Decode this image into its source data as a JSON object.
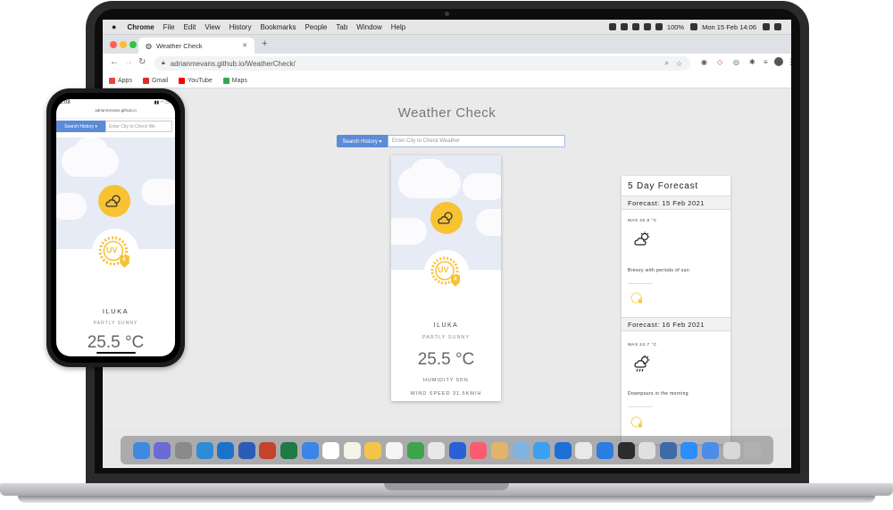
{
  "menubar": {
    "apple": "",
    "app": "Chrome",
    "items": [
      "File",
      "Edit",
      "View",
      "History",
      "Bookmarks",
      "People",
      "Tab",
      "Window",
      "Help"
    ],
    "battery": "100%",
    "datetime": "Mon 15 Feb  14:06"
  },
  "browser": {
    "tab_title": "Weather Check",
    "new_tab": "+",
    "tab_close": "✕",
    "url": "adrianmevans.github.io/WeatherCheck/",
    "bookmarks": [
      {
        "label": "Apps",
        "color": "#e8453c"
      },
      {
        "label": "Gmail",
        "color": "#d93025"
      },
      {
        "label": "YouTube",
        "color": "#ff0000"
      },
      {
        "label": "Maps",
        "color": "#34a853"
      }
    ]
  },
  "app": {
    "title": "Weather Check",
    "search_history_label": "Search History ▾",
    "city_placeholder": "Enter City to Check Weather",
    "city": "ILUKA",
    "condition": "PARTLY SUNNY",
    "temperature": "25.5 °C",
    "humidity": "HUMIDITY 55%",
    "wind": "WIND SPEED 31.5KM/H",
    "uv_text": "UV",
    "uv_index": "4"
  },
  "forecast": {
    "title": "5 Day Forecast",
    "days": [
      {
        "date": "Forecast: 15 Feb 2021",
        "max": "MAX 25.8 °C",
        "desc": "Breezy with periods of sun",
        "uv": "4"
      },
      {
        "date": "Forecast: 16 Feb 2021",
        "max": "MAX 24.7 °C",
        "desc": "Downpours in the morning",
        "uv": "4"
      }
    ]
  },
  "phone": {
    "time": "2:08",
    "url": "adrianmevans.github.io",
    "search_history_label": "Search History ▾",
    "city_placeholder": "Enter City to Check We",
    "city": "ILUKA",
    "condition": "PARTLY SUNNY",
    "temperature": "25.5 °C",
    "uv_index": "4"
  },
  "dock": {
    "colors": [
      "#3f8ae0",
      "#6b6bd6",
      "#8a8a8a",
      "#2f8bd6",
      "#1a73c9",
      "#2b5cb8",
      "#c4432b",
      "#1f7a45",
      "#3b84e8",
      "#ffffff",
      "#f6f3e8",
      "#f3c64a",
      "#f5f5f5",
      "#3fa34d",
      "#e8e8e8",
      "#2a5fd6",
      "#fb5b6e",
      "#e0b56a",
      "#7fb3e0",
      "#3aa0f0",
      "#1d6fd6",
      "#e9e9e9",
      "#2b7de0",
      "#2c2c2c",
      "#e0e0e0",
      "#3f6aa8",
      "#2d8cff",
      "#4a8ee8",
      "#d8d8d8",
      "#b0b0b0"
    ]
  },
  "colors": {
    "accent": "#5b8bd9",
    "sun": "#f7c234",
    "sky": "#e6ebf5"
  }
}
